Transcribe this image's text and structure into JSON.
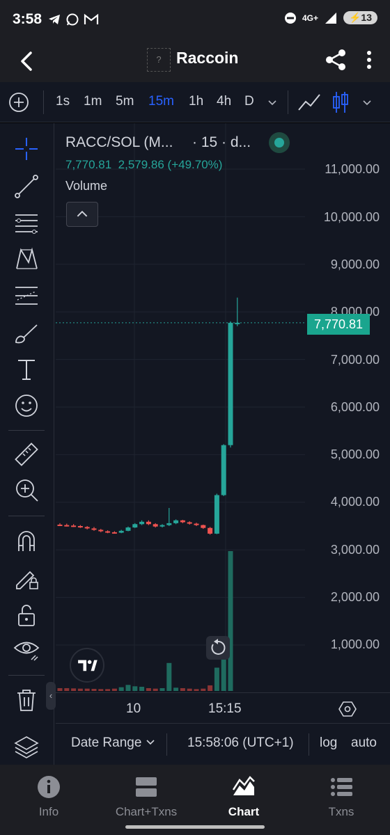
{
  "status_bar": {
    "time": "3:58",
    "network": "4G+",
    "battery": "13",
    "icons": [
      "telegram-icon",
      "whatsapp-icon",
      "gmail-icon",
      "dnd-icon",
      "signal-icon",
      "battery-icon"
    ]
  },
  "header": {
    "title": "Raccoin",
    "logo_placeholder": "?"
  },
  "toolbar": {
    "intervals": [
      "1s",
      "1m",
      "5m",
      "15m",
      "1h",
      "4h",
      "D"
    ],
    "active_interval": "15m"
  },
  "legend": {
    "symbol": "RACC/SOL (M...",
    "interval_text": "· 15 · d...",
    "last_price": "7,770.81",
    "change": "2,579.86 (+49.70%)",
    "volume_label": "Volume"
  },
  "price_axis": {
    "labels": [
      "11,000.00",
      "10,000.00",
      "9,000.00",
      "8,000.00",
      "7,000.00",
      "6,000.00",
      "5,000.00",
      "4,000.00",
      "3,000.00",
      "2,000.00",
      "1,000.00"
    ],
    "current_price_tag": "7,770.81"
  },
  "time_axis": {
    "labels": [
      "10",
      "15:15"
    ]
  },
  "bottom_bar": {
    "date_range": "Date Range",
    "clock": "15:58:06 (UTC+1)",
    "log": "log",
    "auto": "auto"
  },
  "nav": {
    "items": [
      {
        "label": "Info",
        "icon": "info-icon"
      },
      {
        "label": "Chart+Txns",
        "icon": "split-view-icon"
      },
      {
        "label": "Chart",
        "icon": "chart-icon"
      },
      {
        "label": "Txns",
        "icon": "list-icon"
      }
    ],
    "active": "Chart"
  },
  "colors": {
    "up": "#26a69a",
    "down": "#ef5350",
    "accent": "#2962ff",
    "background": "#131722"
  },
  "chart_data": {
    "type": "candlestick",
    "ylim": [
      0,
      11000
    ],
    "current_price": 7770.81,
    "candles": [
      {
        "o": 3530,
        "h": 3560,
        "l": 3500,
        "c": 3520
      },
      {
        "o": 3520,
        "h": 3550,
        "l": 3490,
        "c": 3510
      },
      {
        "o": 3510,
        "h": 3540,
        "l": 3480,
        "c": 3500
      },
      {
        "o": 3500,
        "h": 3520,
        "l": 3460,
        "c": 3480
      },
      {
        "o": 3480,
        "h": 3500,
        "l": 3430,
        "c": 3450
      },
      {
        "o": 3450,
        "h": 3480,
        "l": 3400,
        "c": 3420
      },
      {
        "o": 3420,
        "h": 3440,
        "l": 3370,
        "c": 3390
      },
      {
        "o": 3390,
        "h": 3410,
        "l": 3350,
        "c": 3370
      },
      {
        "o": 3370,
        "h": 3390,
        "l": 3340,
        "c": 3360
      },
      {
        "o": 3360,
        "h": 3420,
        "l": 3350,
        "c": 3400
      },
      {
        "o": 3400,
        "h": 3490,
        "l": 3390,
        "c": 3470
      },
      {
        "o": 3470,
        "h": 3560,
        "l": 3460,
        "c": 3540
      },
      {
        "o": 3540,
        "h": 3620,
        "l": 3520,
        "c": 3590
      },
      {
        "o": 3590,
        "h": 3620,
        "l": 3520,
        "c": 3540
      },
      {
        "o": 3540,
        "h": 3560,
        "l": 3470,
        "c": 3490
      },
      {
        "o": 3490,
        "h": 3540,
        "l": 3470,
        "c": 3520
      },
      {
        "o": 3520,
        "h": 3880,
        "l": 3500,
        "c": 3560
      },
      {
        "o": 3560,
        "h": 3640,
        "l": 3540,
        "c": 3620
      },
      {
        "o": 3620,
        "h": 3630,
        "l": 3560,
        "c": 3580
      },
      {
        "o": 3580,
        "h": 3600,
        "l": 3530,
        "c": 3550
      },
      {
        "o": 3550,
        "h": 3570,
        "l": 3500,
        "c": 3520
      },
      {
        "o": 3520,
        "h": 3530,
        "l": 3440,
        "c": 3460
      },
      {
        "o": 3460,
        "h": 3480,
        "l": 3320,
        "c": 3340
      },
      {
        "o": 3340,
        "h": 4180,
        "l": 3330,
        "c": 4150
      },
      {
        "o": 4150,
        "h": 5220,
        "l": 4130,
        "c": 5200
      },
      {
        "o": 5200,
        "h": 7800,
        "l": 5150,
        "c": 7770.81
      },
      {
        "o": 7770.81,
        "h": 8300,
        "l": 7700,
        "c": 7770.81
      }
    ],
    "volume": [
      60,
      60,
      55,
      50,
      50,
      45,
      40,
      40,
      50,
      80,
      130,
      100,
      90,
      60,
      50,
      60,
      600,
      70,
      60,
      50,
      40,
      50,
      120,
      500,
      900,
      3000,
      0
    ]
  }
}
